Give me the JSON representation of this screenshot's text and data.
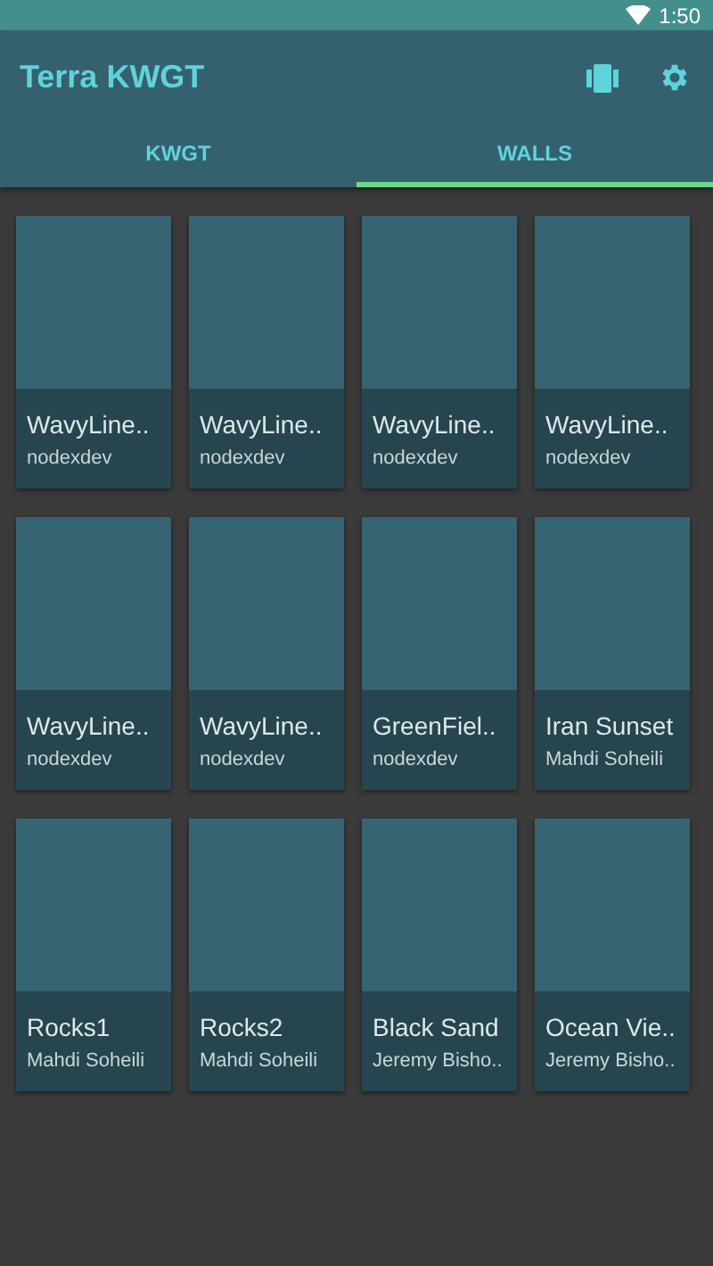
{
  "status_bar": {
    "time": "1:50"
  },
  "app_bar": {
    "title": "Terra KWGT"
  },
  "tabs": [
    {
      "label": "KWGT",
      "selected": false
    },
    {
      "label": "WALLS",
      "selected": true
    }
  ],
  "walls": [
    {
      "title": "WavyLine..",
      "author": "nodexdev"
    },
    {
      "title": "WavyLine..",
      "author": "nodexdev"
    },
    {
      "title": "WavyLine..",
      "author": "nodexdev"
    },
    {
      "title": "WavyLine..",
      "author": "nodexdev"
    },
    {
      "title": "WavyLine..",
      "author": "nodexdev"
    },
    {
      "title": "WavyLine..",
      "author": "nodexdev"
    },
    {
      "title": "GreenFiel..",
      "author": "nodexdev"
    },
    {
      "title": "Iran Sunset",
      "author": "Mahdi Soheili"
    },
    {
      "title": "Rocks1",
      "author": "Mahdi Soheili"
    },
    {
      "title": "Rocks2",
      "author": "Mahdi Soheili"
    },
    {
      "title": "Black Sand",
      "author": "Jeremy Bisho.."
    },
    {
      "title": "Ocean Vie..",
      "author": "Jeremy Bisho.."
    }
  ]
}
